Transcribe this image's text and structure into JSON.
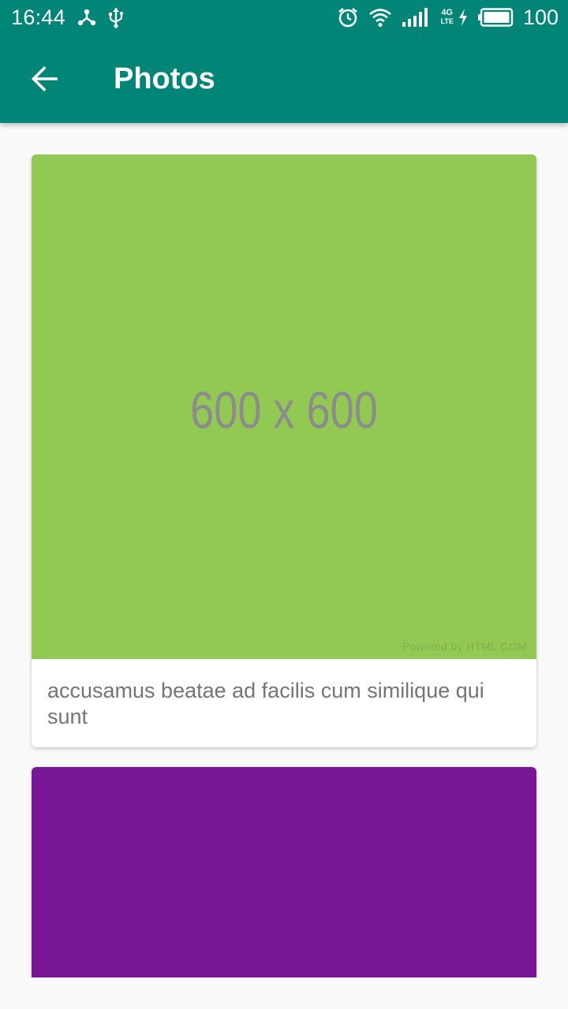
{
  "status_bar": {
    "time": "16:44",
    "battery": "100",
    "network_label_top": "4G",
    "network_label_bottom": "LTE",
    "icons": [
      "share-node-icon",
      "usb-icon",
      "alarm-icon",
      "wifi-icon",
      "signal-icon",
      "charging-icon",
      "battery-icon"
    ]
  },
  "app_bar": {
    "title": "Photos",
    "back_icon": "arrow-left-icon",
    "color": "#008577"
  },
  "photos": [
    {
      "placeholder_text": "600 x 600",
      "watermark": "Powered by HTML.COM",
      "color": "#92c952",
      "title": "accusamus beatae ad facilis cum similique qui sunt"
    },
    {
      "color": "#771796"
    }
  ]
}
